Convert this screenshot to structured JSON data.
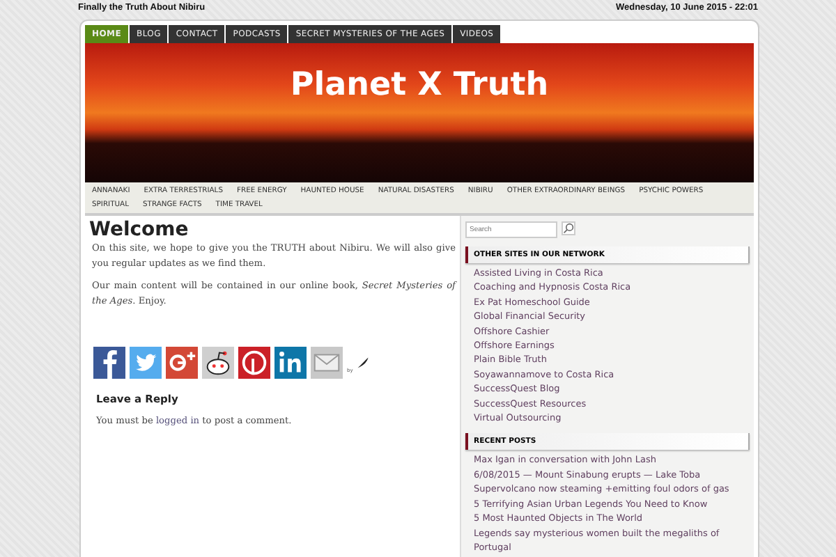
{
  "top_bar": {
    "tagline": "Finally the Truth About Nibiru",
    "datetime": "Wednesday, 10 June 2015 - 22:01"
  },
  "main_nav": [
    {
      "label": "HOME",
      "selected": true
    },
    {
      "label": "BLOG",
      "selected": false
    },
    {
      "label": "CONTACT",
      "selected": false
    },
    {
      "label": "PODCASTS",
      "selected": false
    },
    {
      "label": "SECRET MYSTERIES OF THE AGES",
      "selected": false
    },
    {
      "label": "VIDEOS",
      "selected": false
    }
  ],
  "header": {
    "title": "Planet X Truth"
  },
  "category_nav": [
    "ANNANAKI",
    "EXTRA TERRESTRIALS",
    "FREE ENERGY",
    "HAUNTED HOUSE",
    "NATURAL DISASTERS",
    "NIBIRU",
    "OTHER EXTRAORDINARY BEINGS",
    "PSYCHIC POWERS",
    "SPIRITUAL",
    "STRANGE FACTS",
    "TIME TRAVEL"
  ],
  "post": {
    "title": "Welcome",
    "paragraphs": [
      "On this site, we hope to give you the TRUTH about Nibiru.  We will also give you regular updates as we find them.",
      "Our main content will be contained in our online book, *Secret Mysteries of the Ages*.  Enjoy."
    ],
    "share_icons": [
      {
        "kind": "facebook",
        "color": "#3b5998"
      },
      {
        "kind": "twitter",
        "color": "#55acee"
      },
      {
        "kind": "gplus",
        "color": "#d34836"
      },
      {
        "kind": "reddit",
        "color": "#cfcfcf"
      },
      {
        "kind": "pinterest",
        "color": "#cb2027"
      },
      {
        "kind": "linkedin",
        "color": "#0e76a8"
      },
      {
        "kind": "email",
        "color": "#c8c8c8"
      }
    ],
    "share_by": "by"
  },
  "reply": {
    "title": "Leave a Reply",
    "before": "You must be",
    "link": "logged in",
    "after": "to post a comment."
  },
  "sidebar": {
    "search": {
      "placeholder": "Search"
    },
    "widgets": [
      {
        "title": "OTHER SITES IN OUR NETWORK",
        "links": [
          "Assisted Living in Costa Rica",
          "Coaching and Hypnosis Costa Rica",
          "Ex Pat Homeschool Guide",
          "Global Financial Security",
          "Offshore Cashier",
          "Offshore Earnings",
          "Plain Bible Truth",
          "Soyawannamove to Costa Rica",
          "SuccessQuest Blog",
          "SuccessQuest Resources",
          "Virtual Outsourcing"
        ]
      },
      {
        "title": "RECENT POSTS",
        "links": [
          "Max Igan in conversation with John Lash",
          "6/08/2015 — Mount Sinabung erupts — Lake Toba Supervolcano now steaming +emitting foul odors of gas",
          "5 Terrifying Asian Urban Legends You Need to Know",
          "5 Most Haunted Objects in The World",
          "Legends say mysterious women built the megaliths of Portugal"
        ]
      }
    ]
  }
}
